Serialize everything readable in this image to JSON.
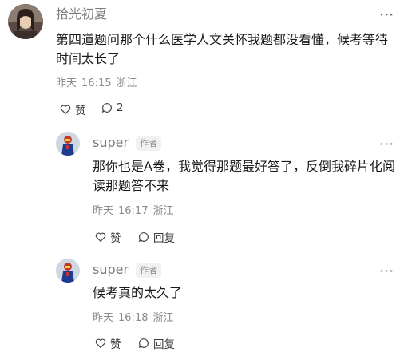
{
  "main_comment": {
    "username": "拾光初夏",
    "content": "第四道题问那个什么医学人文关怀我题都没看懂，候考等待时间太长了",
    "date": "昨天",
    "time": "16:15",
    "location": "浙江",
    "like_label": "赞",
    "reply_count": "2",
    "more_icon": "⋮"
  },
  "replies": [
    {
      "username": "super",
      "author_badge": "作者",
      "content": "那你也是A卷，我觉得那题最好答了，反倒我碎片化阅读那题答不来",
      "date": "昨天",
      "time": "16:17",
      "location": "浙江",
      "like_label": "赞",
      "reply_label": "回复",
      "more_icon": "⋮"
    },
    {
      "username": "super",
      "author_badge": "作者",
      "content": "候考真的太久了",
      "date": "昨天",
      "time": "16:18",
      "location": "浙江",
      "like_label": "赞",
      "reply_label": "回复",
      "more_icon": "⋮"
    }
  ],
  "colors": {
    "meta_gray": "#8a8a8a",
    "username_gray": "#7b7b7b",
    "text": "#1a1a1a"
  }
}
